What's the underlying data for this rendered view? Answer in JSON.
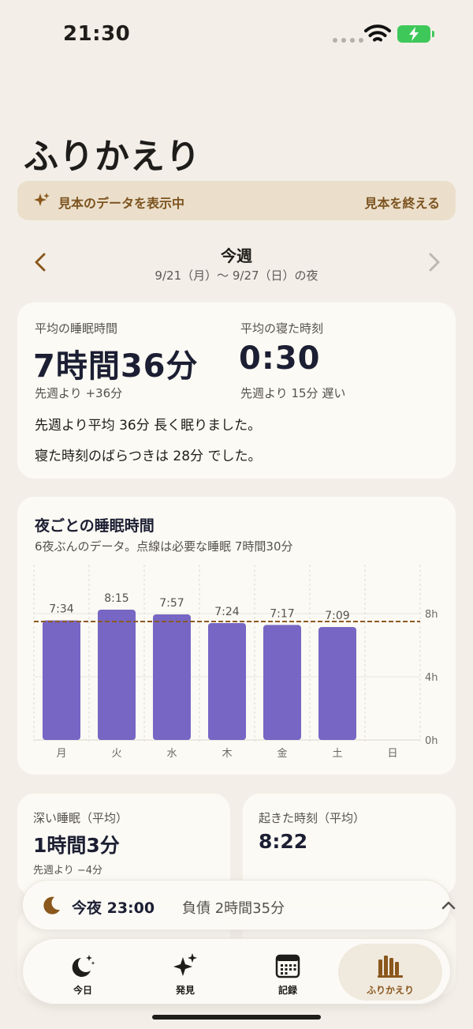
{
  "status": {
    "time": "21:30"
  },
  "header": {
    "title": "ふりかえり"
  },
  "banner": {
    "message": "見本のデータを表示中",
    "end_label": "見本を終える"
  },
  "week": {
    "label": "今週",
    "range": "9/21（月）〜 9/27（日）の夜"
  },
  "summary": {
    "avg_sleep_label": "平均の睡眠時間",
    "avg_sleep_value": "7時間36分",
    "avg_sleep_delta": "先週より +36分",
    "avg_bedtime_label": "平均の寝た時刻",
    "avg_bedtime_value": "0:30",
    "avg_bedtime_delta": "先週より 15分 遅い",
    "line1": "先週より平均 36分 長く眠りました。",
    "line2": "寝た時刻のばらつきは 28分 でした。"
  },
  "chart_data": {
    "type": "bar",
    "title": "夜ごとの睡眠時間",
    "subtitle": "6夜ぶんのデータ。点線は必要な睡眠 7時間30分",
    "categories": [
      "月",
      "火",
      "水",
      "木",
      "金",
      "土",
      "日"
    ],
    "values": [
      7.567,
      8.25,
      7.95,
      7.4,
      7.283,
      7.15,
      null
    ],
    "labels": [
      "7:34",
      "8:15",
      "7:57",
      "7:24",
      "7:17",
      "7:09",
      ""
    ],
    "target": 7.5,
    "ylim": [
      0,
      10
    ],
    "yticks": [
      0,
      4,
      8
    ],
    "ytick_labels": [
      "0h",
      "4h",
      "8h"
    ],
    "colors": {
      "bar": "#7766c4",
      "target": "#8a5a24"
    }
  },
  "deep_sleep": {
    "label": "深い睡眠（平均）",
    "value": "1時間3分",
    "delta": "先週より −4分"
  },
  "wake": {
    "label": "起きた時刻（平均）",
    "value": "8:22"
  },
  "tonight": {
    "time": "今夜 23:00",
    "debt": "負債 2時間35分"
  },
  "tabs": [
    {
      "label": "今日",
      "icon": "moon-stars-icon"
    },
    {
      "label": "発見",
      "icon": "sparkles-icon"
    },
    {
      "label": "記録",
      "icon": "calendar-icon"
    },
    {
      "label": "ふりかえり",
      "icon": "bar-chart-icon"
    }
  ],
  "colors": {
    "accent": "#8a571c",
    "background": "#f3efe8",
    "card": "#fcfaf4"
  }
}
